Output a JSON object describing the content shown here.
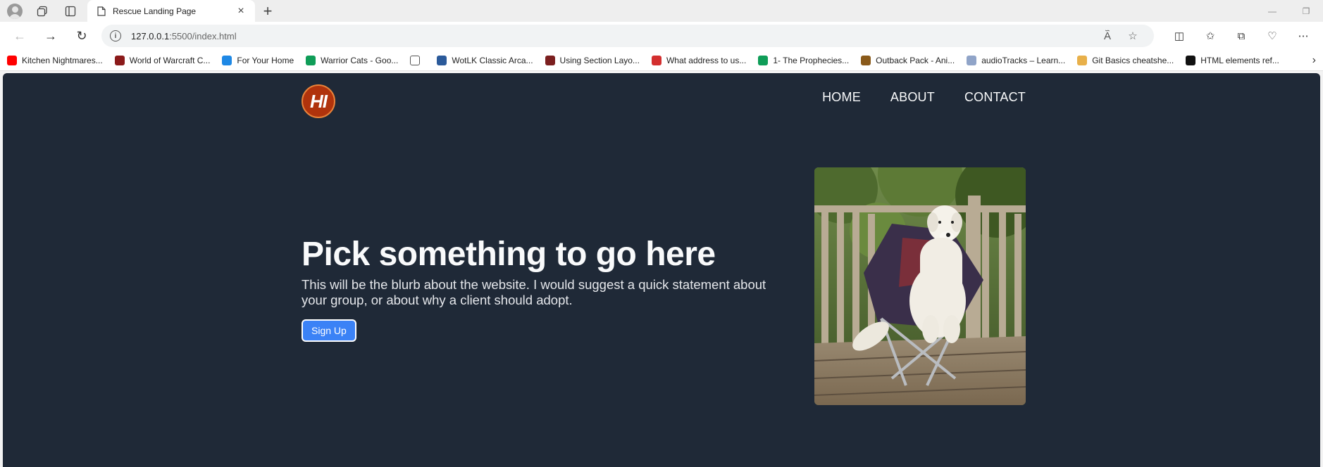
{
  "browser": {
    "tab_title": "Rescue Landing Page",
    "url_host": "127.0.0.1",
    "url_rest": ":5500/index.html",
    "bookmarks": [
      {
        "label": "Kitchen Nightmares...",
        "color": "#ff0000"
      },
      {
        "label": "World of Warcraft C...",
        "color": "#8b1a1a"
      },
      {
        "label": "For Your Home",
        "color": "#1e88e5"
      },
      {
        "label": "Warrior Cats - Goo...",
        "color": "#0f9d58"
      },
      {
        "label": "",
        "color": "#ffffff"
      },
      {
        "label": "WotLK Classic Arca...",
        "color": "#2b5a9a"
      },
      {
        "label": "Using Section Layo...",
        "color": "#7b1f1f"
      },
      {
        "label": "What address to us...",
        "color": "#d32f2f"
      },
      {
        "label": "1- The Prophecies...",
        "color": "#0f9d58"
      },
      {
        "label": "Outback Pack - Ani...",
        "color": "#8a5a1a"
      },
      {
        "label": "audioTracks – Learn...",
        "color": "#90a4c8"
      },
      {
        "label": "Git Basics cheatshe...",
        "color": "#e8b04a"
      },
      {
        "label": "HTML elements ref...",
        "color": "#111111"
      }
    ]
  },
  "site": {
    "logo_text": "HI",
    "nav": {
      "home": "HOME",
      "about": "ABOUT",
      "contact": "CONTACT"
    },
    "hero": {
      "title": "Pick something to go here",
      "blurb": "This will be the blurb about the website. I would suggest a quick statement about your group, or about why a client should adopt.",
      "cta": "Sign Up"
    }
  }
}
